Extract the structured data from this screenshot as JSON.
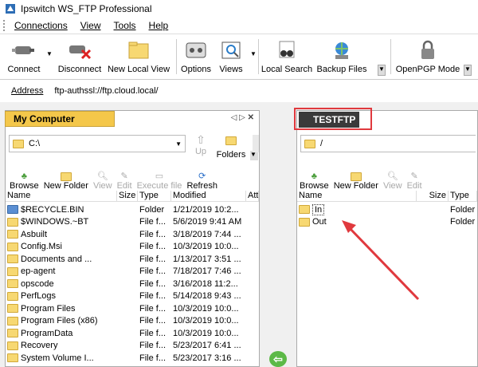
{
  "app": {
    "title": "Ipswitch WS_FTP Professional"
  },
  "menu": [
    "Connections",
    "View",
    "Tools",
    "Help"
  ],
  "toolbar": {
    "connect": "Connect",
    "disconnect": "Disconnect",
    "new_local_view": "New Local View",
    "options": "Options",
    "views": "Views",
    "local_search": "Local Search",
    "backup_files": "Backup Files",
    "openpgp": "OpenPGP Mode"
  },
  "address": {
    "label": "Address",
    "value": "ftp-authssl://ftp.cloud.local/"
  },
  "left": {
    "tab": "My Computer",
    "path": "C:\\",
    "up": "Up",
    "folders": "Folders",
    "tools": {
      "browse": "Browse",
      "new_folder": "New Folder",
      "view": "View",
      "edit": "Edit",
      "execute": "Execute file",
      "refresh": "Refresh"
    },
    "headers": {
      "name": "Name",
      "size": "Size",
      "type": "Type",
      "modified": "Modified",
      "attr": "Att"
    },
    "files": [
      {
        "name": "$RECYCLE.BIN",
        "type": "Folder",
        "modified": "1/21/2019 10:2..."
      },
      {
        "name": "$WINDOWS.~BT",
        "type": "File f...",
        "modified": "5/6/2019 9:41 AM"
      },
      {
        "name": "Asbuilt",
        "type": "File f...",
        "modified": "3/18/2019 7:44 ..."
      },
      {
        "name": "Config.Msi",
        "type": "File f...",
        "modified": "10/3/2019 10:0..."
      },
      {
        "name": "Documents and ...",
        "type": "File f...",
        "modified": "1/13/2017 3:51 ..."
      },
      {
        "name": "ep-agent",
        "type": "File f...",
        "modified": "7/18/2017 7:46 ..."
      },
      {
        "name": "opscode",
        "type": "File f...",
        "modified": "3/16/2018 11:2..."
      },
      {
        "name": "PerfLogs",
        "type": "File f...",
        "modified": "5/14/2018 9:43 ..."
      },
      {
        "name": "Program Files",
        "type": "File f...",
        "modified": "10/3/2019 10:0..."
      },
      {
        "name": "Program Files (x86)",
        "type": "File f...",
        "modified": "10/3/2019 10:0..."
      },
      {
        "name": "ProgramData",
        "type": "File f...",
        "modified": "10/3/2019 10:0..."
      },
      {
        "name": "Recovery",
        "type": "File f...",
        "modified": "5/23/2017 6:41 ..."
      },
      {
        "name": "System Volume I...",
        "type": "File f...",
        "modified": "5/23/2017 3:16 ..."
      }
    ]
  },
  "right": {
    "tab": "TESTFTP",
    "path": "/",
    "tools": {
      "browse": "Browse",
      "new_folder": "New Folder",
      "view": "View",
      "edit": "Edit"
    },
    "headers": {
      "name": "Name",
      "size": "Size",
      "type": "Type"
    },
    "files": [
      {
        "name": "In",
        "type": "Folder"
      },
      {
        "name": "Out",
        "type": "Folder"
      }
    ]
  },
  "colors": {
    "highlight_box": "#e0393e",
    "arrow": "#e0393e",
    "tab_active": "#f4c74a"
  }
}
